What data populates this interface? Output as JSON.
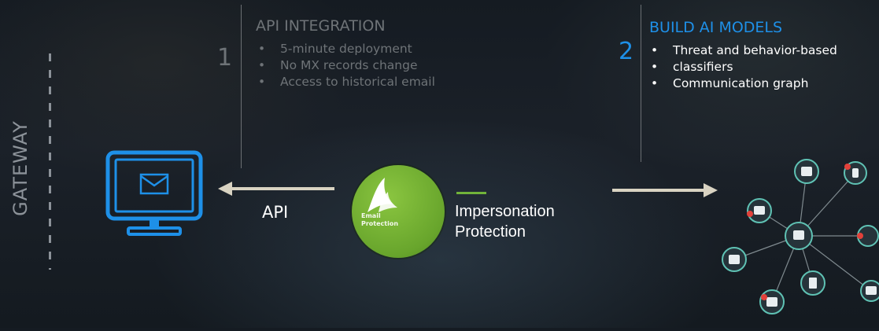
{
  "gateway": {
    "label": "GATEWAY"
  },
  "step1": {
    "number": "1",
    "title": "API INTEGRATION",
    "bullets": [
      "5-minute deployment",
      "No MX records change",
      "Access to historical email"
    ]
  },
  "step2": {
    "number": "2",
    "title": "BUILD AI MODELS",
    "bullets": [
      "Threat and behavior-based",
      "classifiers",
      "Communication graph"
    ]
  },
  "api": {
    "label": "API"
  },
  "badge": {
    "line1": "Email",
    "line2": "Protection"
  },
  "product": {
    "line1": "Impersonation",
    "line2": "Protection"
  },
  "colors": {
    "accent_blue": "#1e90e8",
    "accent_green": "#71b33a",
    "muted_text": "#6e7377",
    "arrow": "#d9d3c2"
  },
  "icons": {
    "monitor": "monitor-email-icon",
    "graph": "communication-graph-icon",
    "badge": "shark-fin-icon"
  }
}
